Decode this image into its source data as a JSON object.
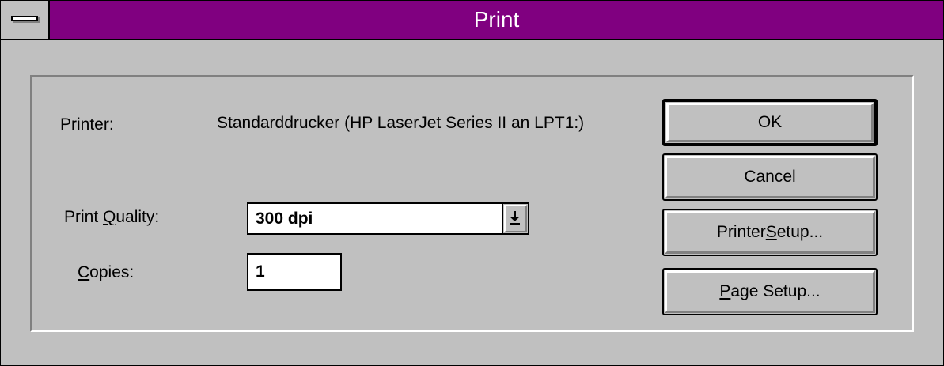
{
  "window": {
    "title": "Print"
  },
  "printer": {
    "label": "Printer:",
    "name": "Standarddrucker (HP LaserJet Series II an LPT1:)"
  },
  "print_quality": {
    "label_pre": "Print ",
    "label_mnemonic": "Q",
    "label_post": "uality:",
    "selected": "300 dpi"
  },
  "copies": {
    "label_mnemonic": "C",
    "label_post": "opies:",
    "value": "1"
  },
  "buttons": {
    "ok": "OK",
    "cancel": "Cancel",
    "printer_setup_pre": "Printer ",
    "printer_setup_mnemonic": "S",
    "printer_setup_post": "etup...",
    "page_setup_mnemonic": "P",
    "page_setup_post": "age Setup..."
  },
  "icons": {
    "system_menu": "system-menu-icon",
    "dropdown": "dropdown-arrow-icon"
  },
  "colors": {
    "titlebar": "#800080",
    "face": "#c0c0c0"
  }
}
